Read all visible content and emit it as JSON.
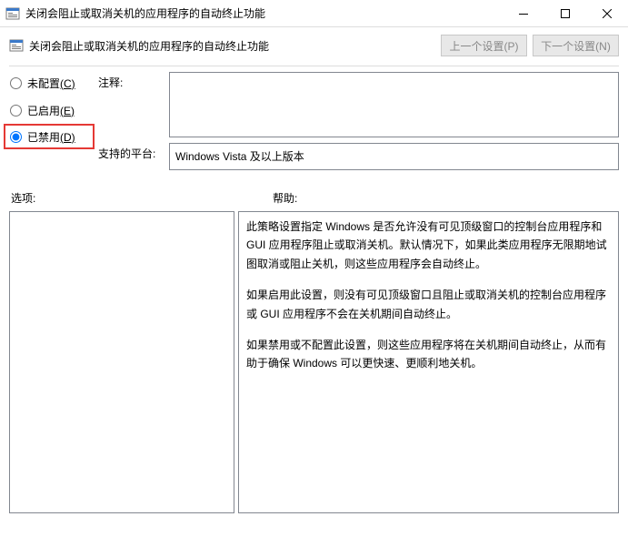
{
  "window": {
    "title": "关闭会阻止或取消关机的应用程序的自动终止功能"
  },
  "header": {
    "policy_title": "关闭会阻止或取消关机的应用程序的自动终止功能",
    "prev_btn": "上一个设置(P)",
    "next_btn": "下一个设置(N)"
  },
  "radios": {
    "not_configured": {
      "label": "未配置",
      "accel": "(C)"
    },
    "enabled": {
      "label": "已启用",
      "accel": "(E)"
    },
    "disabled": {
      "label": "已禁用",
      "accel": "(D)"
    }
  },
  "fields": {
    "comment_label": "注释:",
    "comment_value": "",
    "platform_label": "支持的平台:",
    "platform_value": "Windows Vista 及以上版本"
  },
  "lower": {
    "options_label": "选项:",
    "help_label": "帮助:"
  },
  "help_text": {
    "p1": "此策略设置指定 Windows 是否允许没有可见顶级窗口的控制台应用程序和 GUI 应用程序阻止或取消关机。默认情况下，如果此类应用程序无限期地试图取消或阻止关机，则这些应用程序会自动终止。",
    "p2": "如果启用此设置，则没有可见顶级窗口且阻止或取消关机的控制台应用程序或 GUI 应用程序不会在关机期间自动终止。",
    "p3": "如果禁用或不配置此设置，则这些应用程序将在关机期间自动终止，从而有助于确保 Windows 可以更快速、更顺利地关机。"
  },
  "colors": {
    "highlight": "#e53935"
  }
}
